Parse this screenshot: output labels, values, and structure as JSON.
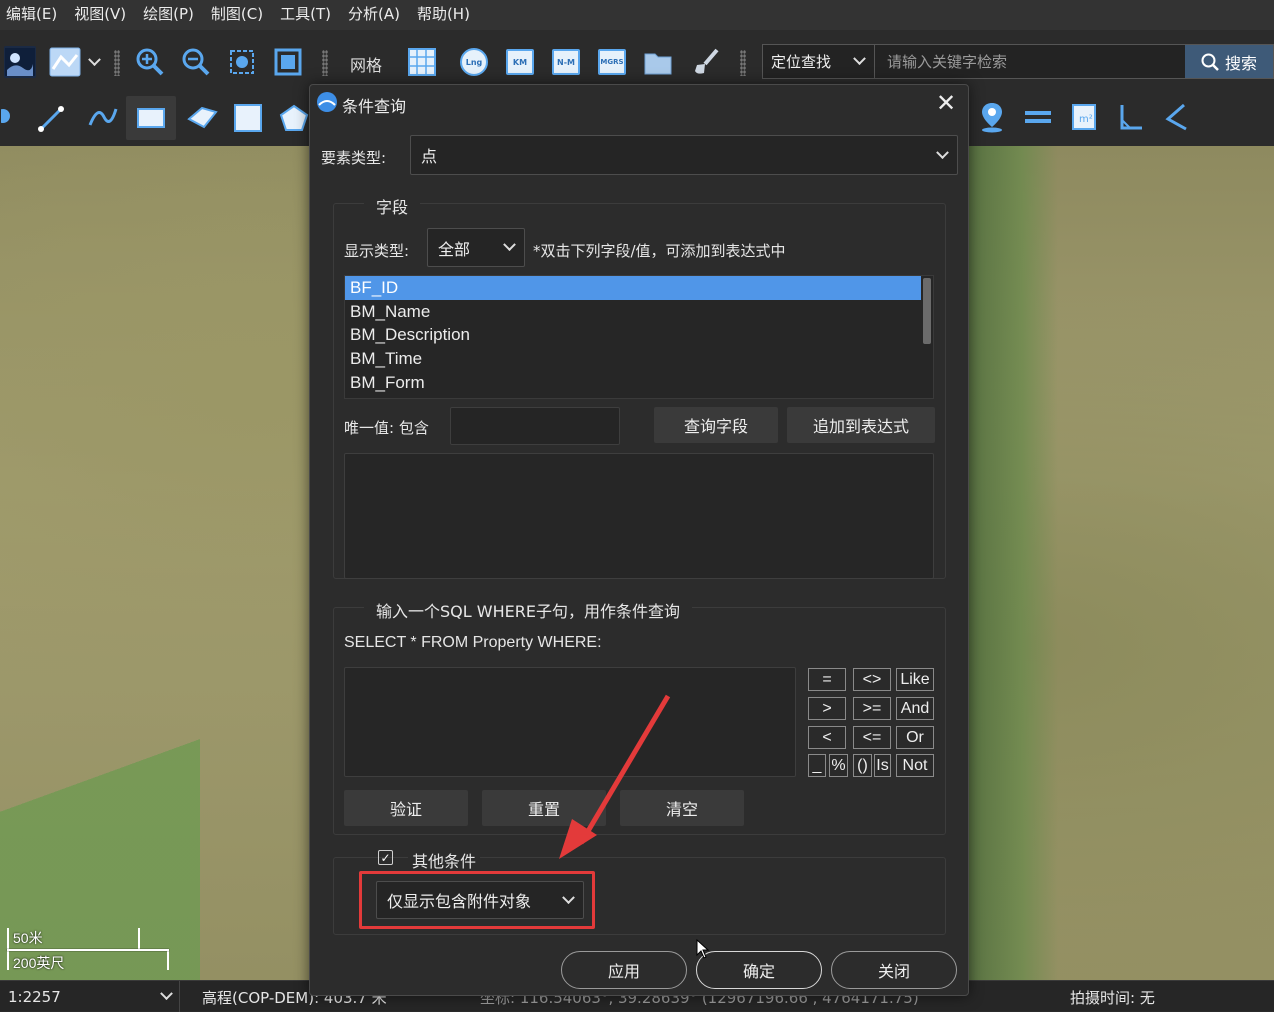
{
  "menu": [
    "编辑(E)",
    "视图(V)",
    "绘图(P)",
    "制图(C)",
    "工具(T)",
    "分析(A)",
    "帮助(H)"
  ],
  "toolbar": {
    "grid_label": "网格",
    "lng_label": "Lng",
    "km_label": "KM",
    "nm_label": "N-M",
    "mgrs_label": "MGRS",
    "location_select": "定位查找",
    "search_placeholder": "请输入关键字检索",
    "search_button": "搜索"
  },
  "dialog": {
    "title": "条件查询",
    "feature_type_label": "要素类型:",
    "feature_type_value": "点",
    "fields_group_title": "字段",
    "display_type_label": "显示类型:",
    "display_type_value": "全部",
    "hint": "*双击下列字段/值，可添加到表达式中",
    "fields": [
      "BF_ID",
      "BM_Name",
      "BM_Description",
      "BM_Time",
      "BM_Form"
    ],
    "selected_field": "BF_ID",
    "unique_label": "唯一值: 包含",
    "unique_value": "",
    "query_field_button": "查询字段",
    "append_expr_button": "追加到表达式",
    "sql_group_title": "输入一个SQL WHERE子句，用作条件查询",
    "sql_prefix": "SELECT * FROM Property WHERE:",
    "operators": [
      "=",
      "<>",
      "Like",
      ">",
      ">=",
      "And",
      "<",
      "<=",
      "Or",
      "_",
      "%",
      "()",
      "Is",
      "Not"
    ],
    "validate_button": "验证",
    "reset_button": "重置",
    "clear_button": "清空",
    "other_conditions_label": "其他条件",
    "other_conditions_checked": true,
    "other_conditions_value": "仅显示包含附件对象",
    "apply_button": "应用",
    "ok_button": "确定",
    "close_button": "关闭"
  },
  "map": {
    "scale_metric": "50米",
    "scale_imperial": "200英尺"
  },
  "status": {
    "scale": "1:2257",
    "elevation": "高程(COP-DEM): 403.7 米",
    "coords": "坐标: 116.54063°, 39.28639°  (12967196.66 , 4764171.75)",
    "shot_time": "拍摄时间: 无"
  },
  "colors": {
    "accent": "#5096e8",
    "highlight": "#e33a3a"
  }
}
